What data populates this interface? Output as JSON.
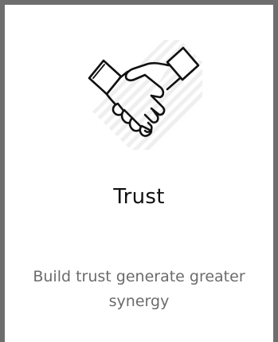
{
  "card": {
    "icon": "handshake-icon",
    "title": "Trust",
    "description": "Build trust generate greater synergy"
  },
  "colors": {
    "border": "#6e6e6e",
    "title": "#111111",
    "description": "#6b6b6b",
    "icon_stroke": "#111111",
    "icon_shadow": "#ececec"
  }
}
